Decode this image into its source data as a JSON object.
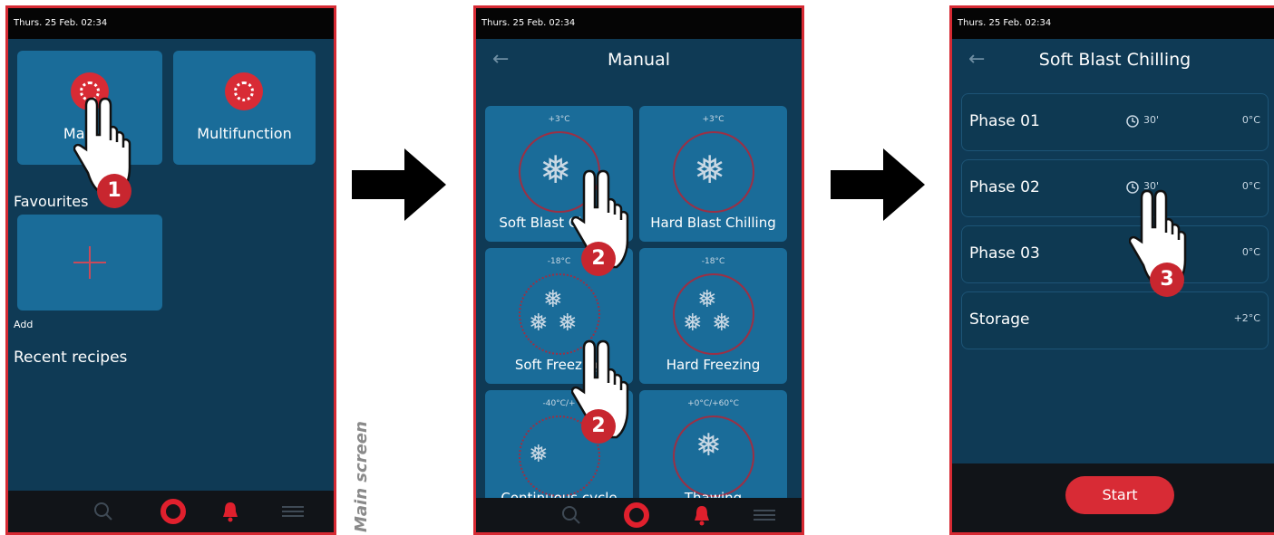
{
  "screen1": {
    "status_time": "Thurs. 25 Feb. 02:34",
    "tiles": [
      {
        "label": "Manual"
      },
      {
        "label": "Multifunction"
      }
    ],
    "favourites_label": "Favourites",
    "add_label": "Add",
    "recent_label": "Recent recipes"
  },
  "screen2": {
    "status_time": "Thurs. 25 Feb. 02:34",
    "title": "Manual",
    "tiles": [
      {
        "label": "Soft Blast Chilling",
        "temp": "+3°C"
      },
      {
        "label": "Hard Blast Chilling",
        "temp": "+3°C"
      },
      {
        "label": "Soft Freezing",
        "temp": "-18°C"
      },
      {
        "label": "Hard Freezing",
        "temp": "-18°C"
      },
      {
        "label": "Continuous cycle",
        "temp": "-40°C/+"
      },
      {
        "label": "Thawing",
        "temp": "+0°C/+60°C"
      }
    ]
  },
  "screen3": {
    "status_time": "Thurs. 25 Feb. 02:34",
    "title": "Soft Blast Chilling",
    "phases": [
      {
        "name": "Phase 01",
        "time": "30'",
        "temp": "0°C"
      },
      {
        "name": "Phase 02",
        "time": "30'",
        "temp": "0°C"
      },
      {
        "name": "Phase 03",
        "time": "",
        "temp": "0°C"
      },
      {
        "name": "Storage",
        "time": "",
        "temp": "+2°C"
      }
    ],
    "start_label": "Start"
  },
  "steps": [
    "1",
    "2",
    "2",
    "3"
  ],
  "side_label": "Main screen",
  "colors": {
    "accent": "#d82b35",
    "frame": "#d62a33",
    "background": "#0f3a55",
    "tile": "#1a6c99"
  },
  "icons": [
    "back-arrow-icon",
    "search-icon",
    "home-icon",
    "bell-icon",
    "menu-icon",
    "clock-icon",
    "snowflake-icon",
    "pointing-hand-icon"
  ]
}
